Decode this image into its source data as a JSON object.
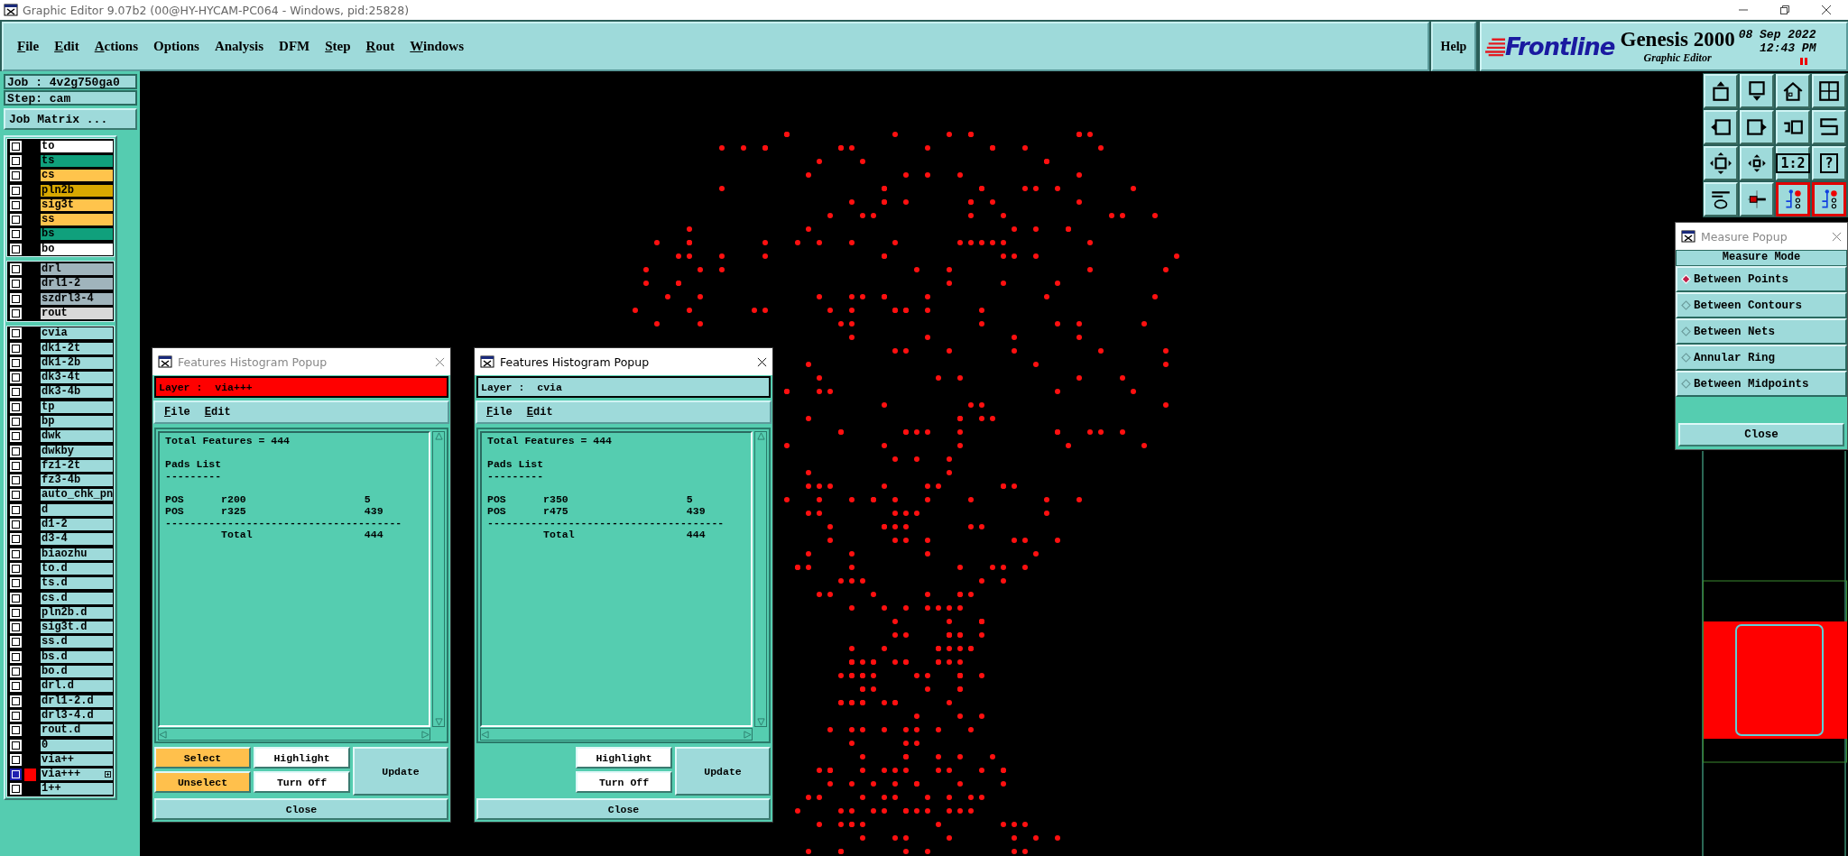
{
  "window": {
    "title": "Graphic Editor 9.07b2 (00@HY-HYCAM-PC064 - Windows, pid:25828)"
  },
  "menu": [
    {
      "label": "File",
      "mnemonic": true
    },
    {
      "label": "Edit",
      "mnemonic": true
    },
    {
      "label": "Actions",
      "mnemonic": true
    },
    {
      "label": "Options",
      "mnemonic": false
    },
    {
      "label": "Analysis",
      "mnemonic": false
    },
    {
      "label": "DFM",
      "mnemonic": false
    },
    {
      "label": "Step",
      "mnemonic": true
    },
    {
      "label": "Rout",
      "mnemonic": true
    },
    {
      "label": "Windows",
      "mnemonic": true
    }
  ],
  "help": "Help",
  "brand": {
    "logo": "Frontline",
    "product": "Genesis 2000",
    "subtitle": "Graphic Editor",
    "date": "08  Sep  2022",
    "time": "12:43  PM"
  },
  "job": {
    "job": "Job : 4v2g750ga0",
    "step": "Step: cam",
    "matrix_button": "Job Matrix ..."
  },
  "layer_groups": [
    [
      {
        "name": "to",
        "color": "#ffffff",
        "selected": false
      },
      {
        "name": "ts",
        "color": "#10a07c",
        "selected": false
      },
      {
        "name": "cs",
        "color": "#ffc44c",
        "selected": false
      },
      {
        "name": "pln2b",
        "color": "#d8a800",
        "selected": false
      },
      {
        "name": "sig3t",
        "color": "#ffc44c",
        "selected": false
      },
      {
        "name": "ss",
        "color": "#ffc44c",
        "selected": false
      },
      {
        "name": "bs",
        "color": "#10a07c",
        "selected": false
      },
      {
        "name": "bo",
        "color": "#ffffff",
        "selected": false
      }
    ],
    [
      {
        "name": "drl",
        "color": "#a0b4bc",
        "selected": false
      },
      {
        "name": "drl1-2",
        "color": "#a0b4bc",
        "selected": false
      },
      {
        "name": "szdrl3-4",
        "color": "#a0b4bc",
        "selected": false
      },
      {
        "name": "rout",
        "color": "#d8d8d8",
        "selected": false
      }
    ],
    [
      {
        "name": "cvia",
        "color": "#9edada",
        "selected": false
      },
      {
        "name": "dk1-2t",
        "color": "#9edada",
        "selected": false
      },
      {
        "name": "dk1-2b",
        "color": "#9edada",
        "selected": false
      },
      {
        "name": "dk3-4t",
        "color": "#9edada",
        "selected": false
      },
      {
        "name": "dk3-4b",
        "color": "#9edada",
        "selected": false
      },
      {
        "name": "tp",
        "color": "#9edada",
        "selected": false
      },
      {
        "name": "bp",
        "color": "#9edada",
        "selected": false
      },
      {
        "name": "dwk",
        "color": "#9edada",
        "selected": false
      },
      {
        "name": "dwkby",
        "color": "#9edada",
        "selected": false
      },
      {
        "name": "fz1-2t",
        "color": "#9edada",
        "selected": false
      },
      {
        "name": "fz3-4b",
        "color": "#9edada",
        "selected": false
      },
      {
        "name": "auto_chk_pn",
        "color": "#9edada",
        "selected": false
      },
      {
        "name": "d",
        "color": "#9edada",
        "selected": false
      },
      {
        "name": "d1-2",
        "color": "#9edada",
        "selected": false
      },
      {
        "name": "d3-4",
        "color": "#9edada",
        "selected": false
      },
      {
        "name": "biaozhu",
        "color": "#9edada",
        "selected": false
      },
      {
        "name": "to.d",
        "color": "#9edada",
        "selected": false
      },
      {
        "name": "ts.d",
        "color": "#9edada",
        "selected": false
      },
      {
        "name": "cs.d",
        "color": "#9edada",
        "selected": false
      },
      {
        "name": "pln2b.d",
        "color": "#9edada",
        "selected": false
      },
      {
        "name": "sig3t.d",
        "color": "#9edada",
        "selected": false
      },
      {
        "name": "ss.d",
        "color": "#9edada",
        "selected": false
      },
      {
        "name": "bs.d",
        "color": "#9edada",
        "selected": false
      },
      {
        "name": "bo.d",
        "color": "#9edada",
        "selected": false
      },
      {
        "name": "drl.d",
        "color": "#9edada",
        "selected": false
      },
      {
        "name": "drl1-2.d",
        "color": "#9edada",
        "selected": false
      },
      {
        "name": "drl3-4.d",
        "color": "#9edada",
        "selected": false
      },
      {
        "name": "rout.d",
        "color": "#9edada",
        "selected": false
      },
      {
        "name": "0",
        "color": "#9edada",
        "selected": false
      },
      {
        "name": "via++",
        "color": "#9edada",
        "selected": false
      },
      {
        "name": "via+++",
        "color": "#9edada",
        "selected": true
      },
      {
        "name": "1++",
        "color": "#9edada",
        "selected": false
      }
    ]
  ],
  "popups": [
    {
      "title": "Features Histogram Popup",
      "focused": false,
      "layer_label": "Layer :",
      "layer": "via+++",
      "highlighted": true,
      "menu": [
        "File",
        "Edit"
      ],
      "total_line": "Total Features = 444",
      "section": "Pads List",
      "section_rule": "---------",
      "rows": [
        {
          "type": "POS",
          "symbol": "r200",
          "count": "5"
        },
        {
          "type": "POS",
          "symbol": "r325",
          "count": "439"
        }
      ],
      "rule": "--------------------------------------",
      "total": {
        "label": "Total",
        "count": "444"
      },
      "select_buttons": [
        "Select",
        "Unselect"
      ],
      "buttons": [
        "Highlight",
        "Turn Off"
      ],
      "update": "Update",
      "close": "Close"
    },
    {
      "title": "Features Histogram Popup",
      "focused": true,
      "layer_label": "Layer :",
      "layer": "cvia",
      "highlighted": false,
      "menu": [
        "File",
        "Edit"
      ],
      "total_line": "Total Features = 444",
      "section": "Pads List",
      "section_rule": "---------",
      "rows": [
        {
          "type": "POS",
          "symbol": "r350",
          "count": "5"
        },
        {
          "type": "POS",
          "symbol": "r475",
          "count": "439"
        }
      ],
      "rule": "--------------------------------------",
      "total": {
        "label": "Total",
        "count": "444"
      },
      "buttons": [
        "Highlight",
        "Turn Off"
      ],
      "update": "Update",
      "close": "Close"
    }
  ],
  "toolbar": [
    {
      "kind": "icon",
      "active": false
    },
    {
      "kind": "icon",
      "active": false
    },
    {
      "kind": "icon",
      "active": false
    },
    {
      "kind": "icon",
      "active": false
    },
    {
      "kind": "icon",
      "active": false
    },
    {
      "kind": "icon",
      "active": false
    },
    {
      "kind": "icon",
      "active": false
    },
    {
      "kind": "icon",
      "active": false
    },
    {
      "kind": "icon",
      "active": false
    },
    {
      "kind": "icon",
      "active": false
    },
    {
      "kind": "text",
      "label": "1:2",
      "active": false
    },
    {
      "kind": "text",
      "label": "?",
      "active": false
    },
    {
      "kind": "icon",
      "active": false
    },
    {
      "kind": "icon",
      "active": false
    },
    {
      "kind": "icon",
      "active": true
    },
    {
      "kind": "icon",
      "active": true
    }
  ],
  "measure_popup": {
    "title": "Measure Popup",
    "header": "Measure Mode",
    "options": [
      {
        "label": "Between Points",
        "selected": true
      },
      {
        "label": "Between Contours",
        "selected": false
      },
      {
        "label": "Between Nets",
        "selected": false
      },
      {
        "label": "Annular Ring",
        "selected": false
      },
      {
        "label": "Between Midpoints",
        "selected": false
      }
    ],
    "close": "Close"
  }
}
